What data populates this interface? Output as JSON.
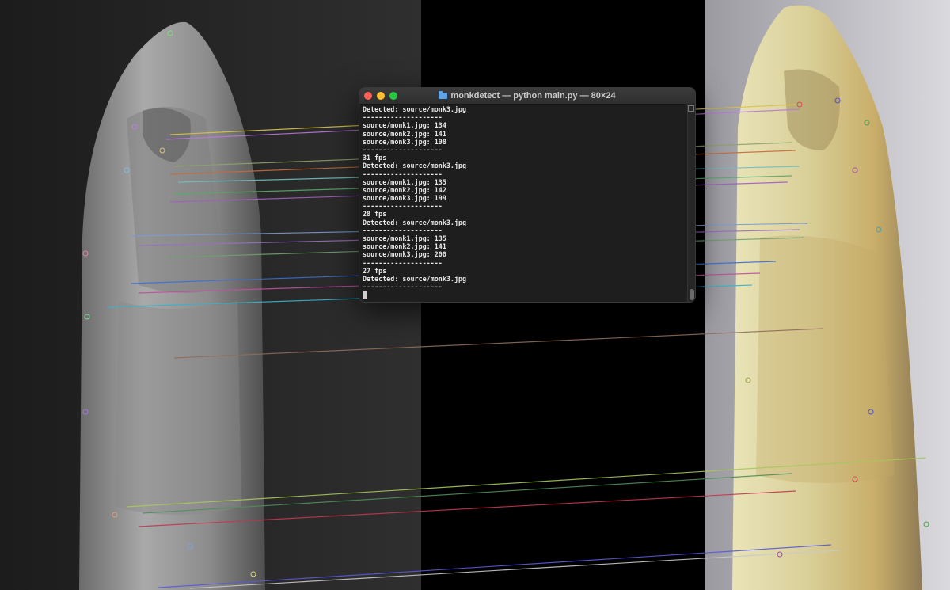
{
  "window": {
    "title": "monkdetect — python main.py — 80×24",
    "title_icon": "folder-icon"
  },
  "terminal": {
    "lines": [
      "Detected: source/monk3.jpg",
      "--------------------",
      "source/monk1.jpg: 134",
      "source/monk2.jpg: 141",
      "source/monk3.jpg: 198",
      "--------------------",
      "31 fps",
      "Detected: source/monk3.jpg",
      "--------------------",
      "source/monk1.jpg: 135",
      "source/monk2.jpg: 142",
      "source/monk3.jpg: 199",
      "--------------------",
      "28 fps",
      "Detected: source/monk3.jpg",
      "--------------------",
      "source/monk1.jpg: 135",
      "source/monk2.jpg: 141",
      "source/monk3.jpg: 200",
      "--------------------",
      "27 fps",
      "Detected: source/monk3.jpg",
      "--------------------"
    ]
  },
  "colors": {
    "terminal_bg": "#1e1e1e",
    "terminal_text": "#e8e8e8",
    "close": "#ff5f57",
    "minimize": "#febc2e",
    "maximize": "#28c840"
  }
}
